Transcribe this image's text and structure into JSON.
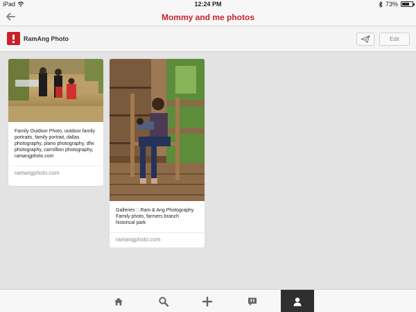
{
  "status_bar": {
    "device": "iPad",
    "time": "12:24 PM",
    "battery_percent": "73%",
    "battery_level": 0.73,
    "wifi_icon": "wifi-icon",
    "bluetooth_icon": "bluetooth-icon"
  },
  "nav": {
    "title": "Mommy and me photos",
    "back_icon": "back-arrow-icon"
  },
  "board": {
    "owner": "RamAng Photo",
    "edit_label": "Edit",
    "send_icon": "send-icon"
  },
  "pins": [
    {
      "image": "family-outdoor-photo",
      "description": "Family Outdoor Photo, outdoor family portraits, family portrait, dallas photography, plano photography, dfw photography, carrollton photography, ramangphoto.com",
      "source": "ramangphoto.com"
    },
    {
      "image": "mother-baby-porch-photo",
      "description": "Galleries :: Ram & Ang Photography Family photo, farmers branch historical park",
      "source": "ramangphoto.com"
    }
  ],
  "tabs": [
    {
      "icon": "home-icon",
      "active": false
    },
    {
      "icon": "search-icon",
      "active": false
    },
    {
      "icon": "plus-icon",
      "active": false
    },
    {
      "icon": "notifications-icon",
      "active": false
    },
    {
      "icon": "profile-icon",
      "active": true
    }
  ],
  "colors": {
    "brand": "#c8232c",
    "background": "#e3e3e3",
    "active_tab": "#2f2f2f"
  }
}
